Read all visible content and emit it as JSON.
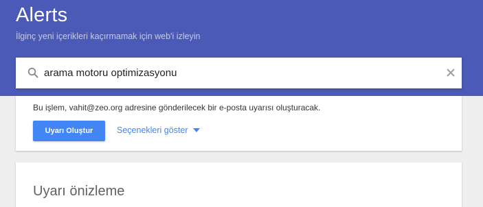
{
  "header": {
    "title": "Alerts",
    "subtitle": "İlginç yeni içerikleri kaçırmamak için web'i izleyin"
  },
  "search": {
    "value": "arama motoru optimizasyonu",
    "search_icon": "search-icon",
    "clear_icon": "close-icon"
  },
  "create_card": {
    "info_text": "Bu işlem, vahit@zeo.org adresine gönderilecek bir e-posta uyarısı oluşturacak.",
    "create_button_label": "Uyarı Oluştur",
    "options_label": "Seçenekleri göster",
    "options_icon": "chevron-down-icon"
  },
  "preview_card": {
    "title": "Uyarı önizleme"
  },
  "colors": {
    "header_bg": "#4c5ab7",
    "accent": "#4285f4",
    "page_bg": "#eeeeee"
  }
}
